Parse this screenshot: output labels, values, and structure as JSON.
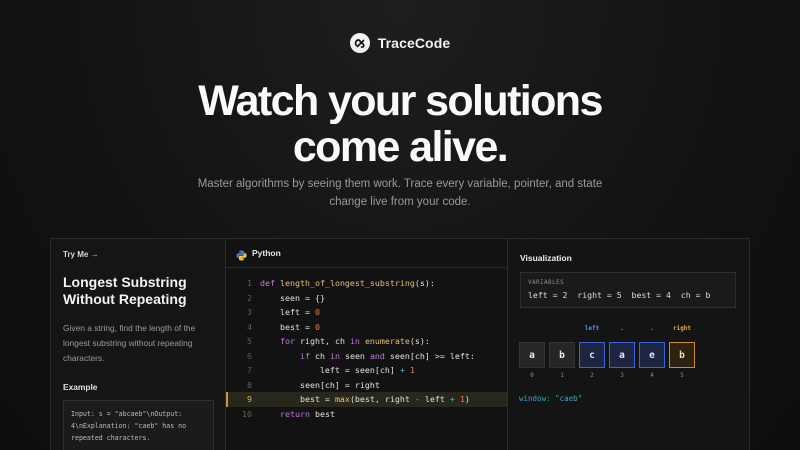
{
  "brand": {
    "name": "TraceCode",
    "logo_icon": "trace-loop-icon"
  },
  "hero": {
    "title_line1": "Watch your solutions",
    "title_line2": "come alive.",
    "subtitle": "Master algorithms by seeing them work. Trace every variable, pointer, and state change live from your code."
  },
  "problem": {
    "try_me": "Try Me →",
    "title": "Longest Substring Without Repeating",
    "description": "Given a string, find the length of the longest substring without repeating characters.",
    "example_label": "Example",
    "example_text": "Input: s = \"abcaeb\"\\nOutput: 4\\nExplanation: \"caeb\" has no repeated characters."
  },
  "code": {
    "language": "Python",
    "language_icon": "python-icon",
    "highlight_line": 9,
    "line_numbers": [
      "1",
      "2",
      "3",
      "4",
      "5",
      "6",
      "7",
      "8",
      "9",
      "10"
    ]
  },
  "visualization": {
    "title": "Visualization",
    "vars_label": "VARIABLES",
    "vars_text": "left = 2  right = 5  best = 4  ch = b",
    "cells": [
      {
        "char": "a",
        "index": "0",
        "pointer": "",
        "state": "normal"
      },
      {
        "char": "b",
        "index": "1",
        "pointer": "",
        "state": "normal"
      },
      {
        "char": "c",
        "index": "2",
        "pointer": "left",
        "state": "window"
      },
      {
        "char": "a",
        "index": "3",
        "pointer": ".",
        "state": "window"
      },
      {
        "char": "e",
        "index": "4",
        "pointer": ".",
        "state": "window"
      },
      {
        "char": "b",
        "index": "5",
        "pointer": "right",
        "state": "right"
      }
    ],
    "window_text": "window: \"caeb\"",
    "colors": {
      "left_pointer": "#5b8cff",
      "right_pointer": "#f0a63a",
      "window": "#3aa7c8"
    }
  }
}
